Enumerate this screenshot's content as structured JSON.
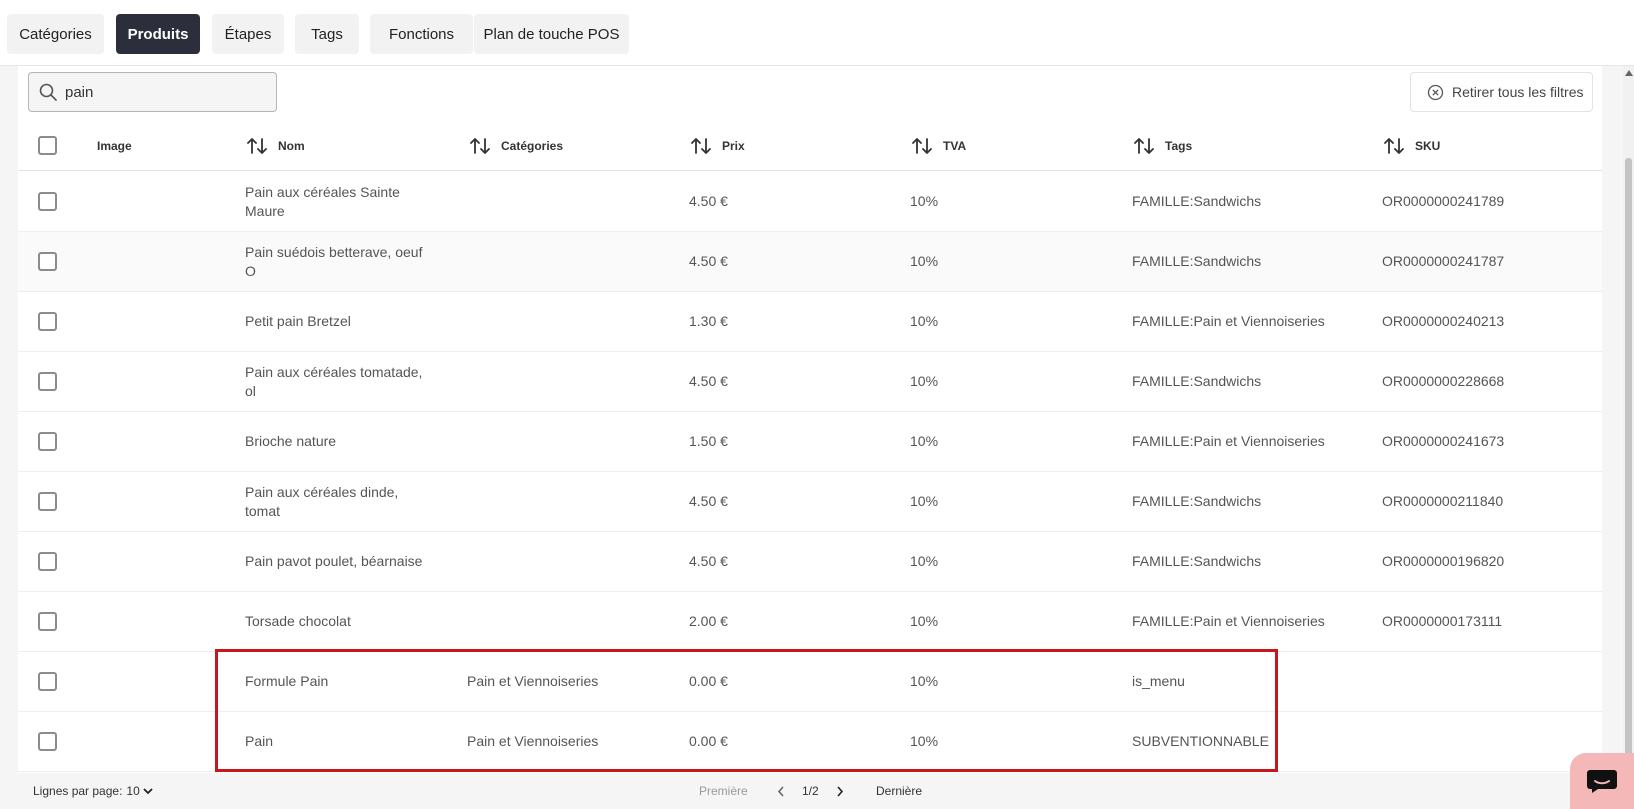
{
  "tabs": [
    {
      "label": "Catégories",
      "active": false
    },
    {
      "label": "Produits",
      "active": true
    },
    {
      "label": "Étapes",
      "active": false
    },
    {
      "label": "Tags",
      "active": false
    },
    {
      "label": "Fonctions",
      "active": false
    },
    {
      "label": "Plan de touche POS",
      "active": false
    }
  ],
  "search": {
    "value": "pain",
    "icon": "search-icon"
  },
  "clear_filters_label": "Retirer tous les filtres",
  "columns": {
    "image": "Image",
    "name": "Nom",
    "categories": "Catégories",
    "price": "Prix",
    "vat": "TVA",
    "tags": "Tags",
    "sku": "SKU"
  },
  "rows": [
    {
      "name": "Pain aux céréales Sainte Maure",
      "categories": "",
      "price": "4.50 €",
      "vat": "10%",
      "tags": "FAMILLE:Sandwichs",
      "sku": "OR0000000241789"
    },
    {
      "name": "Pain suédois betterave, oeuf O",
      "categories": "",
      "price": "4.50 €",
      "vat": "10%",
      "tags": "FAMILLE:Sandwichs",
      "sku": "OR0000000241787"
    },
    {
      "name": "Petit pain Bretzel",
      "categories": "",
      "price": "1.30 €",
      "vat": "10%",
      "tags": "FAMILLE:Pain et Viennoiseries",
      "sku": "OR0000000240213"
    },
    {
      "name": "Pain aux céréales tomatade, ol",
      "categories": "",
      "price": "4.50 €",
      "vat": "10%",
      "tags": "FAMILLE:Sandwichs",
      "sku": "OR0000000228668"
    },
    {
      "name": "Brioche nature",
      "categories": "",
      "price": "1.50 €",
      "vat": "10%",
      "tags": "FAMILLE:Pain et Viennoiseries",
      "sku": "OR0000000241673"
    },
    {
      "name": "Pain aux céréales dinde, tomat",
      "categories": "",
      "price": "4.50 €",
      "vat": "10%",
      "tags": "FAMILLE:Sandwichs",
      "sku": "OR0000000211840"
    },
    {
      "name": "Pain pavot poulet, béarnaise",
      "categories": "",
      "price": "4.50 €",
      "vat": "10%",
      "tags": "FAMILLE:Sandwichs",
      "sku": "OR0000000196820"
    },
    {
      "name": "Torsade chocolat",
      "categories": "",
      "price": "2.00 €",
      "vat": "10%",
      "tags": "FAMILLE:Pain et Viennoiseries",
      "sku": "OR0000000173111"
    },
    {
      "name": "Formule Pain",
      "categories": "Pain et Viennoiseries",
      "price": "0.00 €",
      "vat": "10%",
      "tags": "is_menu",
      "sku": ""
    },
    {
      "name": "Pain",
      "categories": "Pain et Viennoiseries",
      "price": "0.00 €",
      "vat": "10%",
      "tags": "SUBVENTIONNABLE",
      "sku": ""
    }
  ],
  "footer": {
    "rows_per_page_label": "Lignes par page:",
    "rows_per_page_value": "10",
    "first_label": "Première",
    "page_indicator": "1/2",
    "last_label": "Dernière"
  },
  "colors": {
    "active_tab": "#2c2f3b",
    "highlight": "#c8161d",
    "chat_button": "#f4b8b8"
  }
}
